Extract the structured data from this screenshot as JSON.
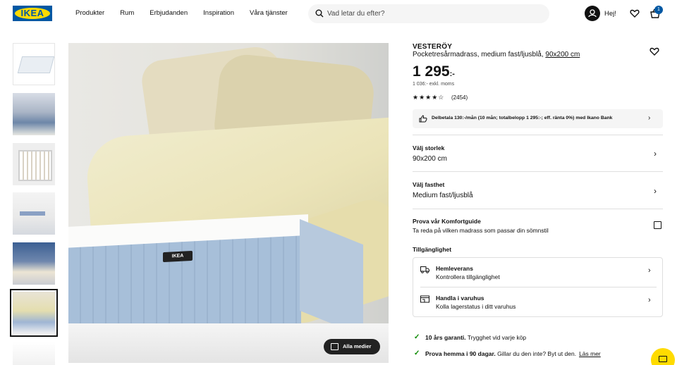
{
  "brand": {
    "logo_text": "IKEA",
    "blue": "#0058a3",
    "yellow": "#ffdb00"
  },
  "nav": {
    "items": [
      "Produkter",
      "Rum",
      "Erbjudanden",
      "Inspiration",
      "Våra tjänster"
    ]
  },
  "search": {
    "placeholder": "Vad letar du efter?"
  },
  "header": {
    "user_label": "Hej!",
    "cart_count": "1"
  },
  "gallery": {
    "thumbnails": [
      "mattress",
      "bedroom-blue",
      "spring-cutaway",
      "floor",
      "room",
      "yellow-bedding",
      "white"
    ],
    "selected_index": 5,
    "mattress_label": "IKEA",
    "media_button_label": "Alla medier"
  },
  "product": {
    "name": "VESTERÖY",
    "description": "Pocketresårmadrass, medium fast/ljusblå, ",
    "size_link": "90x200 cm",
    "price_main": "1 295",
    "price_suffix": ":-",
    "price_ex_vat": "1 036:- exkl. moms",
    "rating_stars": "★★★★☆",
    "rating_value": 4.5,
    "review_count": "(2454)",
    "finance_text": "Delbetala 130:-/mån (10 mån; totalbelopp 1 295:-; eff. ränta 0%) med Ikano Bank"
  },
  "options": {
    "size_label": "Välj storlek",
    "size_value": "90x200 cm",
    "firmness_label": "Välj fasthet",
    "firmness_value": "Medium fast/ljusblå"
  },
  "guide": {
    "title": "Prova vår Komfortguide",
    "subtitle": "Ta reda på vilken madrass som passar din sömnstil"
  },
  "availability": {
    "heading": "Tillgänglighet",
    "rows": [
      {
        "title": "Hemleverans",
        "subtitle": "Kontrollera tillgänglighet",
        "icon": "truck-icon"
      },
      {
        "title": "Handla i varuhus",
        "subtitle": "Kolla lagerstatus i ditt varuhus",
        "icon": "store-icon"
      }
    ]
  },
  "benefits": [
    {
      "bold": "10 års garanti.",
      "text": " Trygghet vid varje köp"
    },
    {
      "bold": "Prova hemma i 90 dagar.",
      "text": " Gillar du den inte? Byt ut den.",
      "link": "Läs mer"
    }
  ]
}
